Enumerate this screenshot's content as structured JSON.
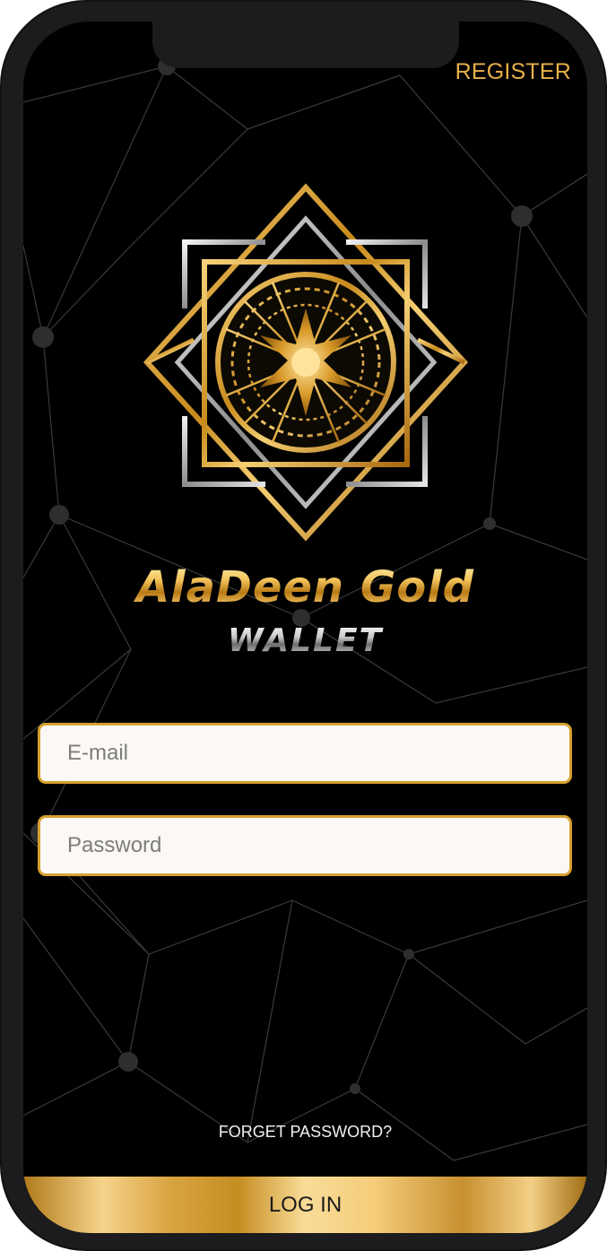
{
  "app": {
    "title": "AlaDeen Gold",
    "subtitle": "WALLET"
  },
  "header": {
    "register_label": "REGISTER"
  },
  "form": {
    "email_placeholder": "E-mail",
    "email_value": "",
    "password_placeholder": "Password",
    "password_value": ""
  },
  "links": {
    "forget_password_label": "FORGET PASSWORD?"
  },
  "actions": {
    "login_label": "LOG IN"
  },
  "colors": {
    "accent_gold": "#d6a12f",
    "background": "#000000",
    "register_text": "#e8b04a"
  },
  "icons": {
    "logo": "aladeen-gold-emblem"
  }
}
